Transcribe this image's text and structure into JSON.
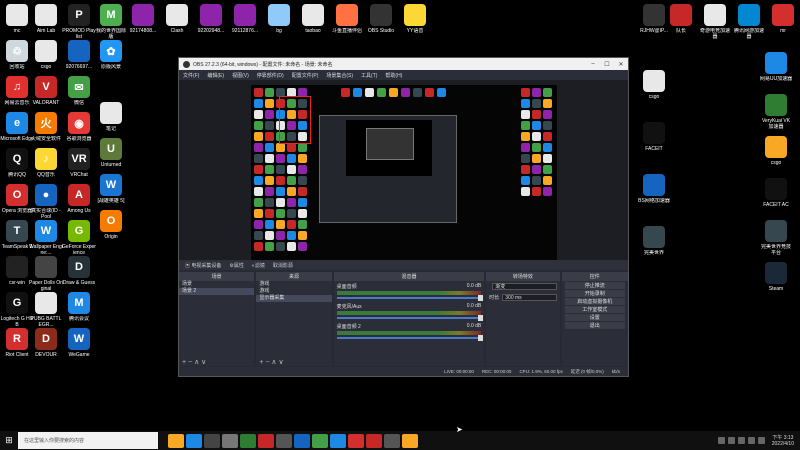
{
  "desktop": {
    "col1": [
      {
        "label": "mc",
        "color": "#e8e8e8",
        "glyph": ""
      },
      {
        "label": "回收站",
        "color": "#cfd8dc",
        "glyph": "♲"
      },
      {
        "label": "网易云音乐",
        "color": "#e0312f",
        "glyph": "♫"
      },
      {
        "label": "Microsoft Edge",
        "color": "#1e88e5",
        "glyph": "e"
      },
      {
        "label": "腾讯QQ",
        "color": "#111",
        "glyph": "Q"
      },
      {
        "label": "Opera 浏览器",
        "color": "#d32f2f",
        "glyph": "O"
      },
      {
        "label": "TeamSpeak 3",
        "color": "#37474f",
        "glyph": "T"
      },
      {
        "label": "csr-win",
        "color": "#222",
        "glyph": ""
      },
      {
        "label": "Logitech G HUB",
        "color": "#111",
        "glyph": "G"
      },
      {
        "label": "Riot Client",
        "color": "#d32f2f",
        "glyph": "R"
      }
    ],
    "col2": [
      {
        "label": "Aim Lab",
        "color": "#e8e8e8",
        "glyph": ""
      },
      {
        "label": "csgo",
        "color": "#e8e8e8",
        "glyph": ""
      },
      {
        "label": "VALORANT",
        "color": "#c62828",
        "glyph": "V"
      },
      {
        "label": "火绒安全软件",
        "color": "#f57c00",
        "glyph": "火"
      },
      {
        "label": "QQ音乐",
        "color": "#fdd835",
        "glyph": "♪"
      },
      {
        "label": "真实合球(ID - Pool",
        "color": "#1565c0",
        "glyph": "●"
      },
      {
        "label": "Wallpaper Engine:...",
        "color": "#1e88e5",
        "glyph": "W"
      },
      {
        "label": "Paper Dolls Original",
        "color": "#444",
        "glyph": ""
      },
      {
        "label": "PUBG BATTLEGR...",
        "color": "#e8e8e8",
        "glyph": ""
      },
      {
        "label": "DEVOUR",
        "color": "#8d2b1b",
        "glyph": "D"
      }
    ],
    "col3": [
      {
        "label": "PROMOD Playlist",
        "color": "#222",
        "glyph": "P"
      },
      {
        "label": "92076697...",
        "color": "#1565c0",
        "glyph": ""
      },
      {
        "label": "微信",
        "color": "#43a047",
        "glyph": "✉"
      },
      {
        "label": "谷歌浏览器",
        "color": "#e53935",
        "glyph": "◉"
      },
      {
        "label": "VRChat",
        "color": "#222",
        "glyph": "VR"
      },
      {
        "label": "Among Us",
        "color": "#c62828",
        "glyph": "A"
      },
      {
        "label": "GeForce Experience",
        "color": "#76b900",
        "glyph": "G"
      },
      {
        "label": "Draw & Guess",
        "color": "#263238",
        "glyph": "D"
      },
      {
        "label": "腾讯会议",
        "color": "#1e88e5",
        "glyph": "M"
      },
      {
        "label": "WeGame",
        "color": "#1565c0",
        "glyph": "W"
      }
    ],
    "col4": [
      {
        "label": "我的世界国际版",
        "color": "#4caf50",
        "glyph": "M"
      },
      {
        "label": "原版风景",
        "color": "#2196f3",
        "glyph": "✿"
      },
      {
        "label": "笔记",
        "color": "#e8e8e8",
        "glyph": ""
      },
      {
        "label": "Unturned",
        "color": "#5d7a3a",
        "glyph": "U"
      },
      {
        "label": "[战雄英雄 5]",
        "color": "#1976d2",
        "glyph": "W"
      },
      {
        "label": "Origin",
        "color": "#f57c00",
        "glyph": "O"
      }
    ],
    "toprow": [
      {
        "label": "92174808...",
        "color": "#8e24aa"
      },
      {
        "label": "Clash",
        "color": "#e8e8e8"
      },
      {
        "label": "92202948...",
        "color": "#8e24aa"
      },
      {
        "label": "92112876...",
        "color": "#8e24aa"
      },
      {
        "label": "bg",
        "color": "#90caf9"
      },
      {
        "label": "taobao",
        "color": "#e8e8e8"
      },
      {
        "label": "斗鱼直播伴侣",
        "color": "#ff7043"
      },
      {
        "label": "OBS Studio",
        "color": "#333"
      },
      {
        "label": "YY语音",
        "color": "#fdd835"
      }
    ],
    "rightcol1": [
      {
        "label": "RJHW@IP...",
        "color": "#333"
      },
      {
        "label": "csgo",
        "color": "#e8e8e8"
      },
      {
        "label": "FACEIT",
        "color": "#111"
      },
      {
        "label": "BS网络加速器",
        "color": "#1565c0"
      },
      {
        "label": "完美世界",
        "color": "#37474f"
      }
    ],
    "rightcol_top": [
      {
        "label": "队长",
        "color": "#c62828"
      },
      {
        "label": "奇游电竞加速器",
        "color": "#e8e8e8"
      },
      {
        "label": "腾讯网游加速器",
        "color": "#0288d1"
      },
      {
        "label": "mr",
        "color": "#d32f2f"
      }
    ],
    "rightcol2": [
      {
        "label": "网易UU加速器",
        "color": "#1e88e5"
      },
      {
        "label": "VeryKuai VK 加速器",
        "color": "#2e7d32"
      },
      {
        "label": "csgo",
        "color": "#f9a825"
      },
      {
        "label": "FACEIT AC",
        "color": "#111"
      },
      {
        "label": "完美世界竞技平台",
        "color": "#37474f"
      },
      {
        "label": "Steam",
        "color": "#1b2838"
      }
    ]
  },
  "obs": {
    "title": "OBS 27.2.3 (64-bit, windows) - 配置文件: 未命名 - 场景: 未命名",
    "menu": [
      "文件(F)",
      "编辑(E)",
      "视图(V)",
      "停靠部件(D)",
      "配置文件(P)",
      "场景集合(S)",
      "工具(T)",
      "帮助(H)"
    ],
    "source_bar": [
      "▣ 电视采集设备",
      "⚙属性",
      "◐滤镜",
      "取消影源"
    ],
    "scenes_title": "场景",
    "scenes": [
      "场景",
      "场景 2"
    ],
    "sources_title": "来源",
    "sources": [
      "游戏",
      "游戏",
      "显示器采集"
    ],
    "mixer_title": "混音器",
    "mixer": [
      {
        "name": "桌面音频",
        "db": "0.0 dB"
      },
      {
        "name": "麦克风/Aux",
        "db": "0.0 dB"
      },
      {
        "name": "桌面音频 2",
        "db": "0.0 dB"
      }
    ],
    "transitions_title": "转场特效",
    "transition_type": "渐变",
    "duration_label": "时长",
    "duration_value": "300 ms",
    "controls_title": "控件",
    "controls": [
      "停止推流",
      "开始录制",
      "启动虚拟摄像机",
      "工作室模式",
      "设置",
      "退出"
    ],
    "dock_foot": "+ − ∧ ∨",
    "status": [
      "LIVE: 00:00:00",
      "REC: 00:00:00",
      "CPU: 1.9%, 60.00 fps",
      "延迟 (0 帧/0.0%)",
      "kb/s"
    ]
  },
  "taskbar": {
    "start_glyph": "⊞",
    "search_placeholder": "在这里输入你要搜索的内容",
    "apps": [
      "#f9a825",
      "#1e88e5",
      "#444",
      "#777",
      "#2e7d32",
      "#c62828",
      "#555",
      "#1565c0",
      "#43a047",
      "#1e88e5",
      "#d32f2f",
      "#c62828",
      "#555",
      "#f9a825"
    ],
    "time": "下午 3:13",
    "date": "2022/4/10"
  }
}
